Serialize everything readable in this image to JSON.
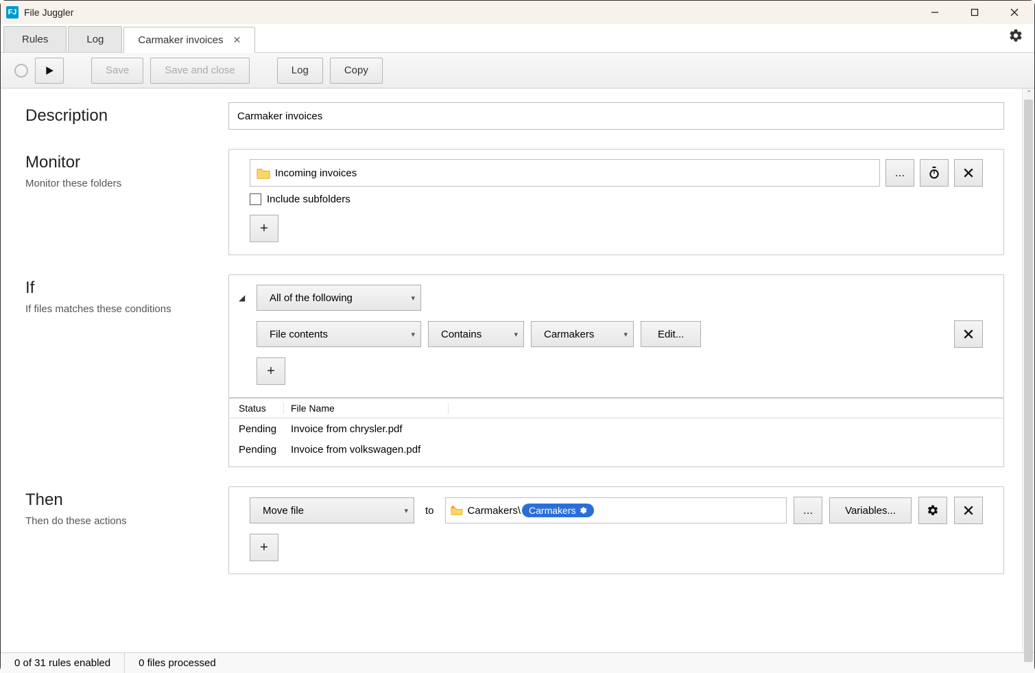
{
  "app": {
    "title": "File Juggler",
    "icon_letters": "FJ"
  },
  "tabs": {
    "rules": "Rules",
    "log": "Log",
    "active": "Carmaker invoices"
  },
  "toolbar": {
    "save": "Save",
    "save_close": "Save and close",
    "log": "Log",
    "copy": "Copy"
  },
  "sections": {
    "description": {
      "title": "Description",
      "value": "Carmaker invoices"
    },
    "monitor": {
      "title": "Monitor",
      "subtitle": "Monitor these folders",
      "folder": "Incoming invoices",
      "browse": "...",
      "include_sub": "Include subfolders"
    },
    "if": {
      "title": "If",
      "subtitle": "If files matches these conditions",
      "group": "All of the following",
      "field": "File contents",
      "op": "Contains",
      "val": "Carmakers",
      "edit": "Edit...",
      "table": {
        "h_status": "Status",
        "h_name": "File Name",
        "rows": [
          {
            "status": "Pending",
            "name": "Invoice from chrysler.pdf"
          },
          {
            "status": "Pending",
            "name": "Invoice from volkswagen.pdf"
          }
        ]
      }
    },
    "then": {
      "title": "Then",
      "subtitle": "Then do these actions",
      "action": "Move file",
      "to": "to",
      "dest_prefix": "Carmakers\\",
      "dest_var": "Carmakers",
      "browse": "...",
      "variables": "Variables..."
    }
  },
  "status": {
    "left": "0 of 31 rules enabled",
    "right": "0 files processed"
  }
}
